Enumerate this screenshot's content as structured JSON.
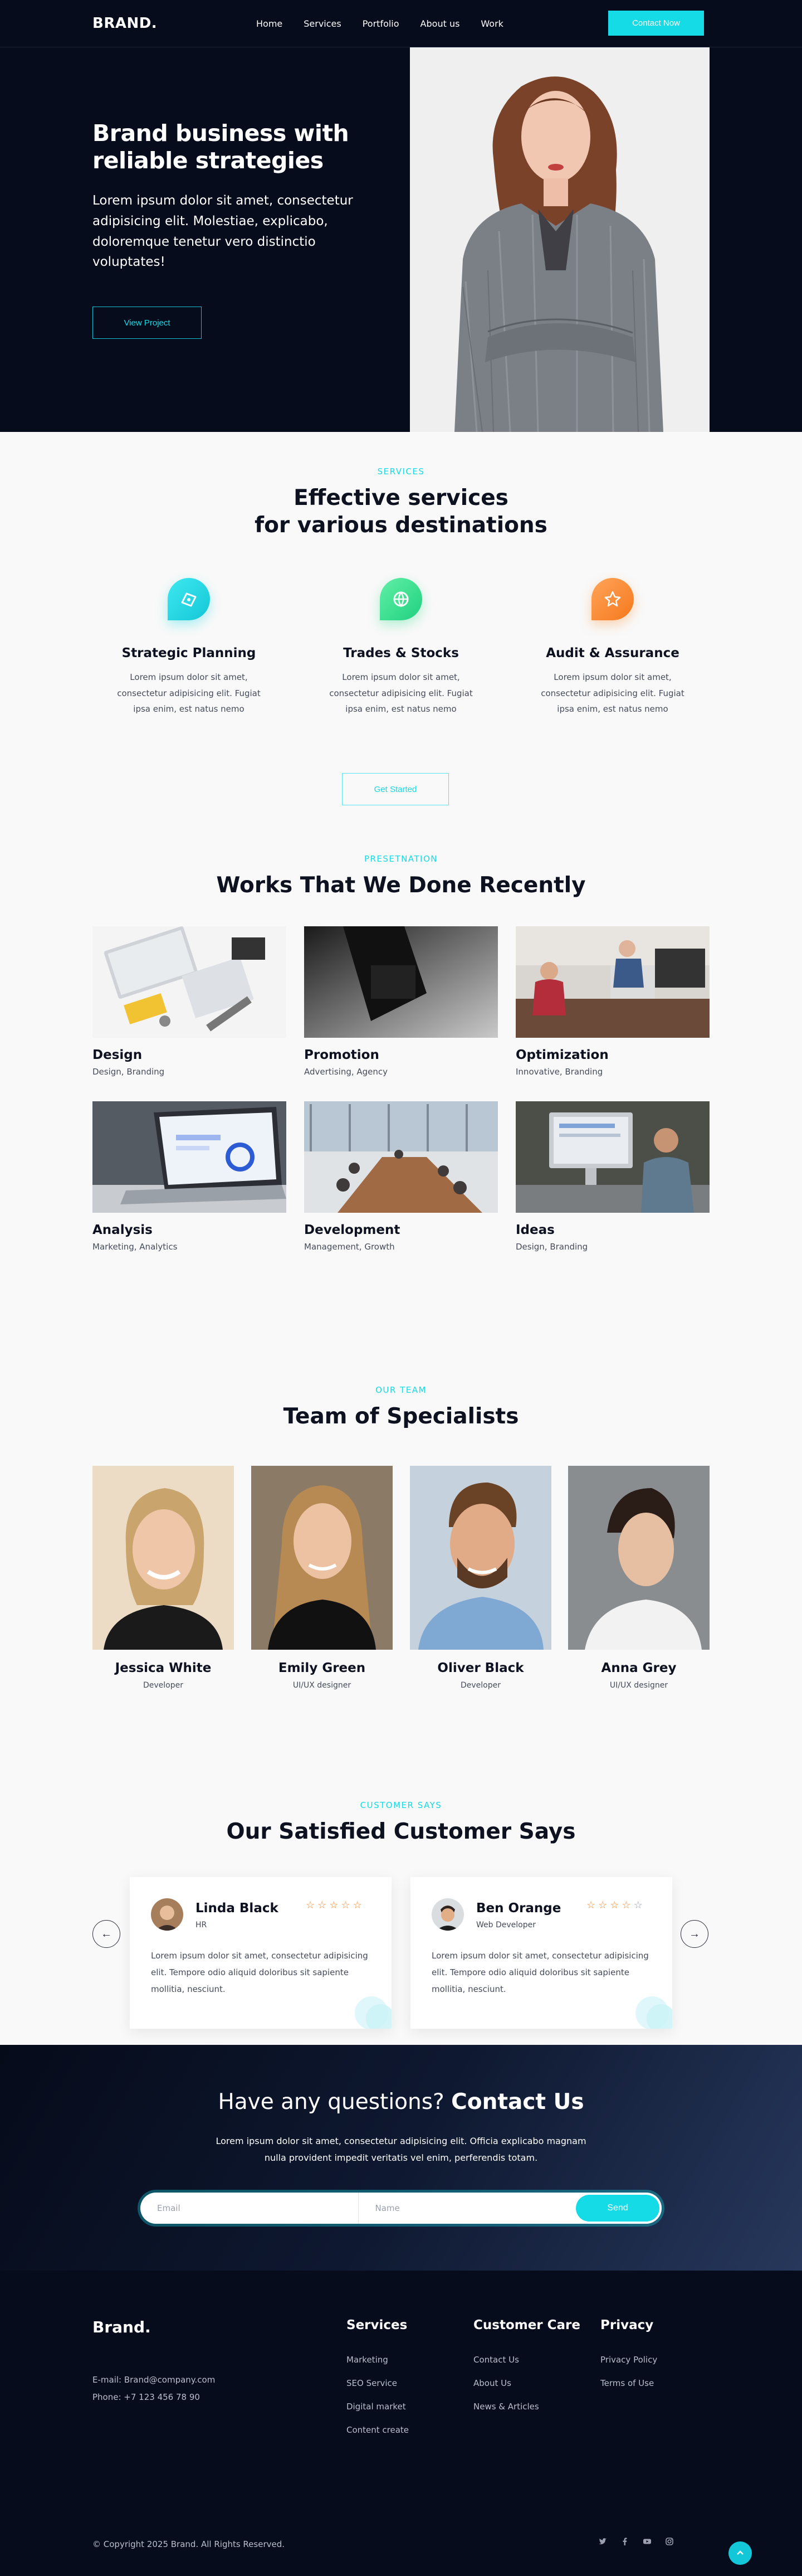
{
  "nav": {
    "logo": "BRAND.",
    "links": [
      "Home",
      "Services",
      "Portfolio",
      "About us",
      "Work"
    ],
    "cta": "Contact Now"
  },
  "hero": {
    "title": "Brand business with reliable strategies",
    "text": "Lorem ipsum dolor sit amet, consectetur adipisicing elit. Molestiae, explicabo, doloremque tenetur vero distinctio voluptates!",
    "button": "View Project"
  },
  "services": {
    "label": "SERVICES",
    "title_line1": "Effective services",
    "title_line2": "for various destinations",
    "items": [
      {
        "title": "Strategic Planning",
        "text": "Lorem ipsum dolor sit amet, consectetur adipisicing elit. Fugiat ipsa enim, est natus nemo",
        "icon": "strategy-icon",
        "color": "#14dbe6"
      },
      {
        "title": "Trades & Stocks",
        "text": "Lorem ipsum dolor sit amet, consectetur adipisicing elit. Fugiat ipsa enim, est natus nemo",
        "icon": "globe-icon",
        "color": "#2ee08a"
      },
      {
        "title": "Audit & Assurance",
        "text": "Lorem ipsum dolor sit amet, consectetur adipisicing elit. Fugiat ipsa enim, est natus nemo",
        "icon": "star-icon",
        "color": "#ff8a2b"
      }
    ],
    "button": "Get Started"
  },
  "works": {
    "label": "PRESETNATION",
    "title": "Works That We Done Recently",
    "items": [
      {
        "title": "Design",
        "tags": "Design, Branding"
      },
      {
        "title": "Promotion",
        "tags": "Advertising, Agency"
      },
      {
        "title": "Optimization",
        "tags": "Innovative, Branding"
      },
      {
        "title": "Analysis",
        "tags": "Marketing, Analytics"
      },
      {
        "title": "Development",
        "tags": "Management, Growth"
      },
      {
        "title": "Ideas",
        "tags": "Design, Branding"
      }
    ]
  },
  "team": {
    "label": "OUR TEAM",
    "title": "Team of Specialists",
    "members": [
      {
        "name": "Jessica White",
        "role": "Developer"
      },
      {
        "name": "Emily Green",
        "role": "UI/UX designer"
      },
      {
        "name": "Oliver Black",
        "role": "Developer"
      },
      {
        "name": "Anna Grey",
        "role": "UI/UX designer"
      }
    ]
  },
  "testimonials": {
    "label": "CUSTOMER SAYS",
    "title": "Our Satisfied Customer Says",
    "prev": "←",
    "next": "→",
    "items": [
      {
        "name": "Linda Black",
        "role": "HR",
        "stars": "★★★★★",
        "rating": 5,
        "text": "Lorem ipsum dolor sit amet, consectetur adipisicing elit. Tempore odio aliquid doloribus sit sapiente mollitia, nesciunt."
      },
      {
        "name": "Ben Orange",
        "role": "Web Developer",
        "stars": "★★★★☆",
        "rating": 4,
        "text": "Lorem ipsum dolor sit amet, consectetur adipisicing elit. Tempore odio aliquid doloribus sit sapiente mollitia, nesciunt."
      }
    ]
  },
  "contact": {
    "title_light": "Have any questions?",
    "title_bold": "Contact Us",
    "text": "Lorem ipsum dolor sit amet, consectetur adipisicing elit. Officia explicabo magnam nulla provident impedit veritatis vel enim, perferendis totam.",
    "email_placeholder": "Email",
    "name_placeholder": "Name",
    "send": "Send"
  },
  "footer": {
    "logo": "Brand.",
    "email": "E-mail: Brand@company.com",
    "phone": "Phone: +7 123 456 78 90",
    "columns": [
      {
        "title": "Services",
        "links": [
          "Marketing",
          "SEO Service",
          "Digital market",
          "Content create"
        ]
      },
      {
        "title": "Customer Care",
        "links": [
          "Contact Us",
          "About Us",
          "News & Articles"
        ]
      },
      {
        "title": "Privacy",
        "links": [
          "Privacy Policy",
          "Terms of Use"
        ]
      }
    ],
    "copyright": "© Copyright 2025 Brand. All Rights Reserved.",
    "social": [
      "twitter-icon",
      "facebook-icon",
      "youtube-icon",
      "instagram-icon"
    ],
    "to_top": "back-to-top-icon"
  },
  "colors": {
    "accent": "#14dbe6",
    "dark": "#070c1c",
    "star": "#ff8a2b"
  }
}
